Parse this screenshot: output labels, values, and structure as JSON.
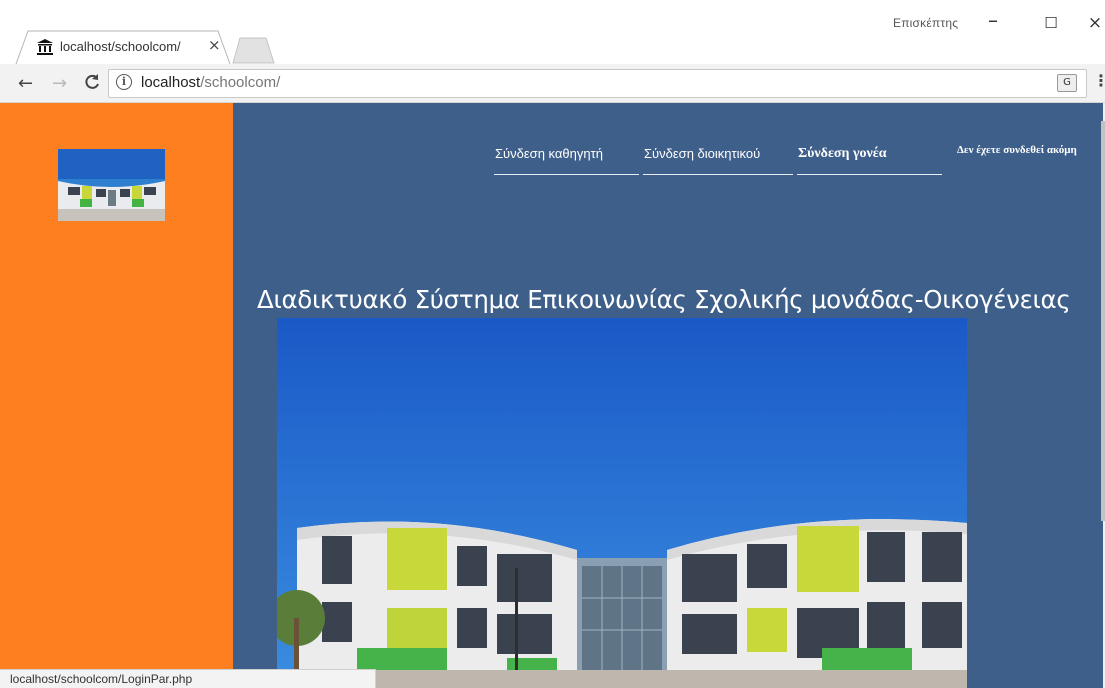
{
  "browser": {
    "tab_title": "localhost/schoolcom/",
    "tab_close_symbol": "×",
    "profile_name": "Επισκέπτης",
    "url_host": "localhost",
    "url_path": "/schoolcom/",
    "info_symbol": "i",
    "translate_symbol": "G",
    "menu_symbol": "⋮",
    "back_symbol": "←",
    "forward_symbol": "→",
    "reload_symbol": "C",
    "minimize_symbol": "–",
    "maximize_symbol": "☐",
    "close_symbol": "×",
    "status_url": "localhost/schoolcom/LoginPar.php",
    "icons": [
      "bank-icon",
      "close-icon",
      "back-arrow-icon",
      "forward-arrow-icon",
      "reload-icon",
      "info-icon",
      "translate-icon",
      "kebab-menu-icon"
    ]
  },
  "colors": {
    "sidebar": "#fd7f20",
    "main": "#3e5f8a",
    "text": "#ffffff"
  },
  "nav": {
    "items": [
      {
        "label": "Σύνδεση καθηγητή"
      },
      {
        "label": "Σύνδεση διοικητικού"
      },
      {
        "label": "Σύνδεση γονέα"
      }
    ],
    "status_note": "Δεν έχετε συνδεθεί ακόμη"
  },
  "page": {
    "title": "Διαδικτυακό Σύστημα Επικοινωνίας Σχολικής μονάδας-Οικογένειας"
  }
}
